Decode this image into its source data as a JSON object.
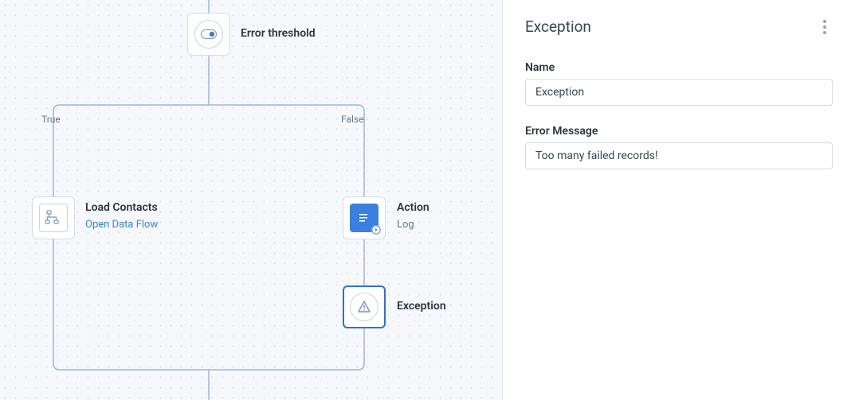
{
  "panel": {
    "title": "Exception",
    "fields": {
      "name_label": "Name",
      "name_value": "Exception",
      "error_label": "Error Message",
      "error_value": "Too many failed records!"
    }
  },
  "flow": {
    "nodes": {
      "root": {
        "label": "Error threshold"
      },
      "branches": {
        "true_label": "True",
        "false_label": "False"
      },
      "load_contacts": {
        "label": "Load Contacts",
        "link_text": "Open Data Flow"
      },
      "action": {
        "label": "Action",
        "sublabel": "Log"
      },
      "exception": {
        "label": "Exception"
      }
    }
  }
}
